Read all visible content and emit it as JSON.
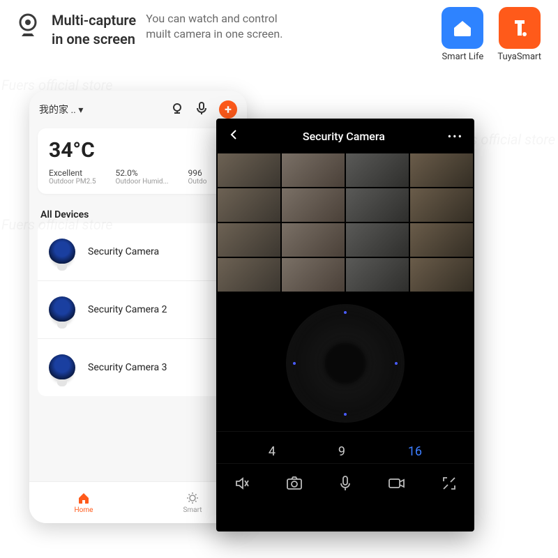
{
  "banner": {
    "title_l1": "Multi-capture",
    "title_l2": "in one screen",
    "sub_l1": "You can watch and control",
    "sub_l2": "muilt camera in one screen."
  },
  "brands": {
    "smartlife": "Smart Life",
    "tuya": "TuyaSmart"
  },
  "home_app": {
    "home_dropdown": "我的家 .. ▾",
    "temperature": "34°C",
    "metrics": [
      {
        "value": "Excellent",
        "label": "Outdoor PM2.5"
      },
      {
        "value": "52.0%",
        "label": "Outdoor Humid..."
      },
      {
        "value": "996",
        "label": "Outdo"
      }
    ],
    "section": "All Devices",
    "devices": [
      "Security Camera",
      "Security Camera 2",
      "Security Camera 3"
    ],
    "nav": {
      "home": "Home",
      "smart": "Smart"
    }
  },
  "camera_app": {
    "title": "Security Camera",
    "counts": [
      "4",
      "9",
      "16"
    ],
    "active_count_index": 2
  }
}
